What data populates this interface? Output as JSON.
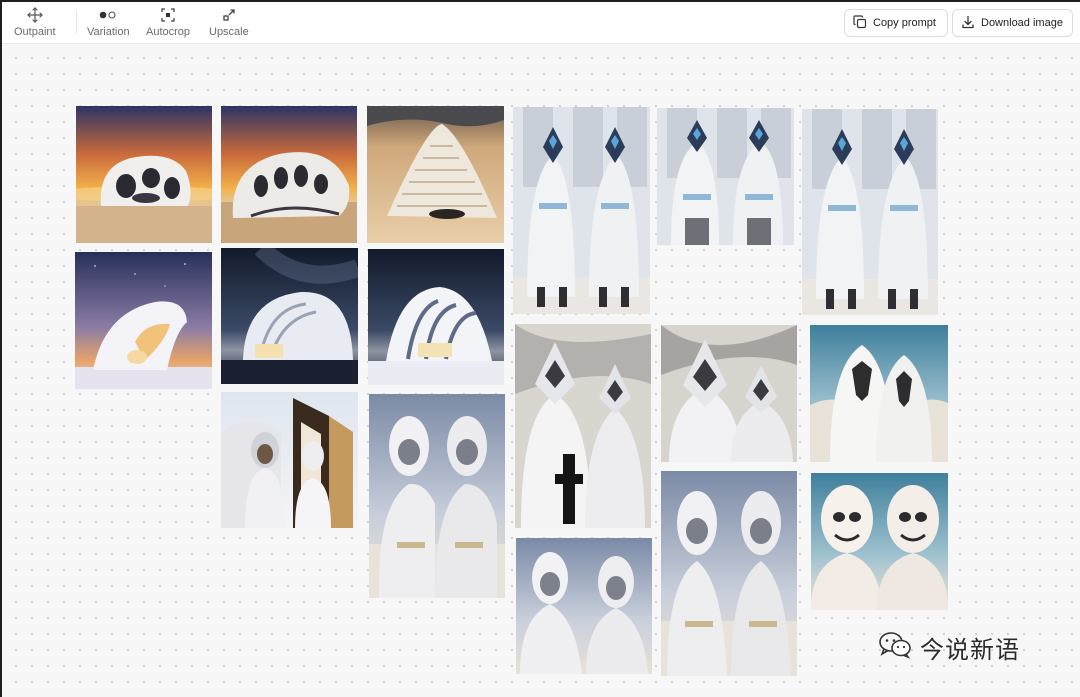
{
  "toolbar": {
    "tools": [
      {
        "label": "Outpaint",
        "icon": "move-arrows-icon"
      },
      {
        "label": "Variation",
        "icon": "variation-dots-icon"
      },
      {
        "label": "Autocrop",
        "icon": "autocrop-icon"
      },
      {
        "label": "Upscale",
        "icon": "upscale-icon"
      }
    ],
    "copy_prompt": {
      "label": "Copy prompt",
      "icon": "copy-icon"
    },
    "download_image": {
      "label": "Download image",
      "icon": "download-icon"
    }
  },
  "gallery": {
    "images": [
      {
        "subject": "white organic house in desert at sunset"
      },
      {
        "subject": "white organic house in desert at sunset, side view"
      },
      {
        "subject": "white layered pyramid structure in sand dunes"
      },
      {
        "subject": "two hooded masked figures in white robes"
      },
      {
        "subject": "two hooded masked figures in white robes"
      },
      {
        "subject": "two hooded masked figures in white robes"
      },
      {
        "subject": "white curved house under starry dusk sky"
      },
      {
        "subject": "white shell-shaped building at night"
      },
      {
        "subject": "white wave building at night"
      },
      {
        "subject": "masked figures in white armor with rifle"
      },
      {
        "subject": "masked figures in white armor"
      },
      {
        "subject": "white hooded alien masks"
      },
      {
        "subject": "two figures in white hoods before arched gate"
      },
      {
        "subject": "two masked figures in white bodysuits"
      },
      {
        "subject": "two masked figures in white bodysuits"
      },
      {
        "subject": "two masked figures in white bodysuits"
      },
      {
        "subject": "two smiling white masked figures"
      },
      {
        "subject": "two masked figures in white bodysuits, close view"
      }
    ]
  },
  "watermark": {
    "text": "今说新语",
    "icon": "wechat-icon"
  }
}
